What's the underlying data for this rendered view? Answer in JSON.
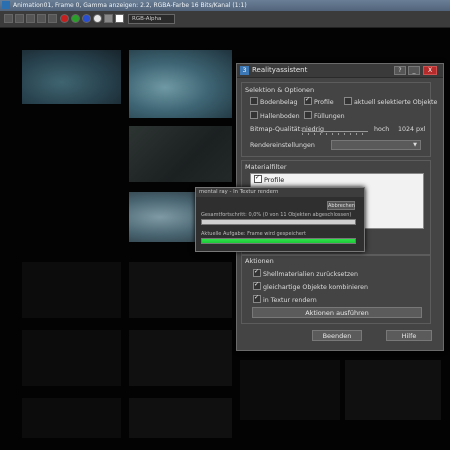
{
  "window_title": "Animation01, Frame 0, Gamma anzeigen: 2.2, RGBA-Farbe 16 Bits/Kanal (1:1)",
  "toolbar": {
    "channel_select": "RGB-Alpha"
  },
  "dialog": {
    "title": "Realityassistent",
    "help_button": "?",
    "minimize_button": "_",
    "close_button": "X",
    "selection": {
      "label": "Selektion & Optionen",
      "options": [
        {
          "label": "Bodenbelag",
          "checked": false
        },
        {
          "label": "Profile",
          "checked": true
        },
        {
          "label": "aktuell selektierte Objekte",
          "checked": false
        },
        {
          "label": "Hallenboden",
          "checked": false
        },
        {
          "label": "Füllungen",
          "checked": false
        }
      ],
      "bitmap_quality_label": "Bitmap-Qualität:",
      "quality_low": "niedrig",
      "quality_high": "hoch",
      "quality_value": "1024 pxl",
      "render_settings_label": "Rendereinstellungen",
      "render_settings_value": ""
    },
    "material_filter": {
      "label": "Materialfilter",
      "items": [
        {
          "label": "Profile",
          "checked": true
        }
      ]
    },
    "actions": {
      "label": "Aktionen",
      "options": [
        {
          "label": "Shellmaterialien zurücksetzen",
          "checked": true
        },
        {
          "label": "gleichartige Objekte kombinieren",
          "checked": true
        },
        {
          "label": "in Textur rendern",
          "checked": true
        }
      ],
      "run_button": "Aktionen ausführen"
    },
    "finish_button": "Beenden",
    "help_text_button": "Hilfe"
  },
  "progress_dialog": {
    "title": "mental ray - In Textur rendern",
    "cancel_button": "Abbrechen",
    "overall_label": "Gesamtfortschritt: 0,0% (0 von 11 Objekten abgeschlossen)",
    "overall_progress": 0,
    "current_label": "Aktuelle Aufgabe: Frame wird gespeichert",
    "current_progress": 100,
    "colors": {
      "bar": "#1ec83a"
    }
  }
}
